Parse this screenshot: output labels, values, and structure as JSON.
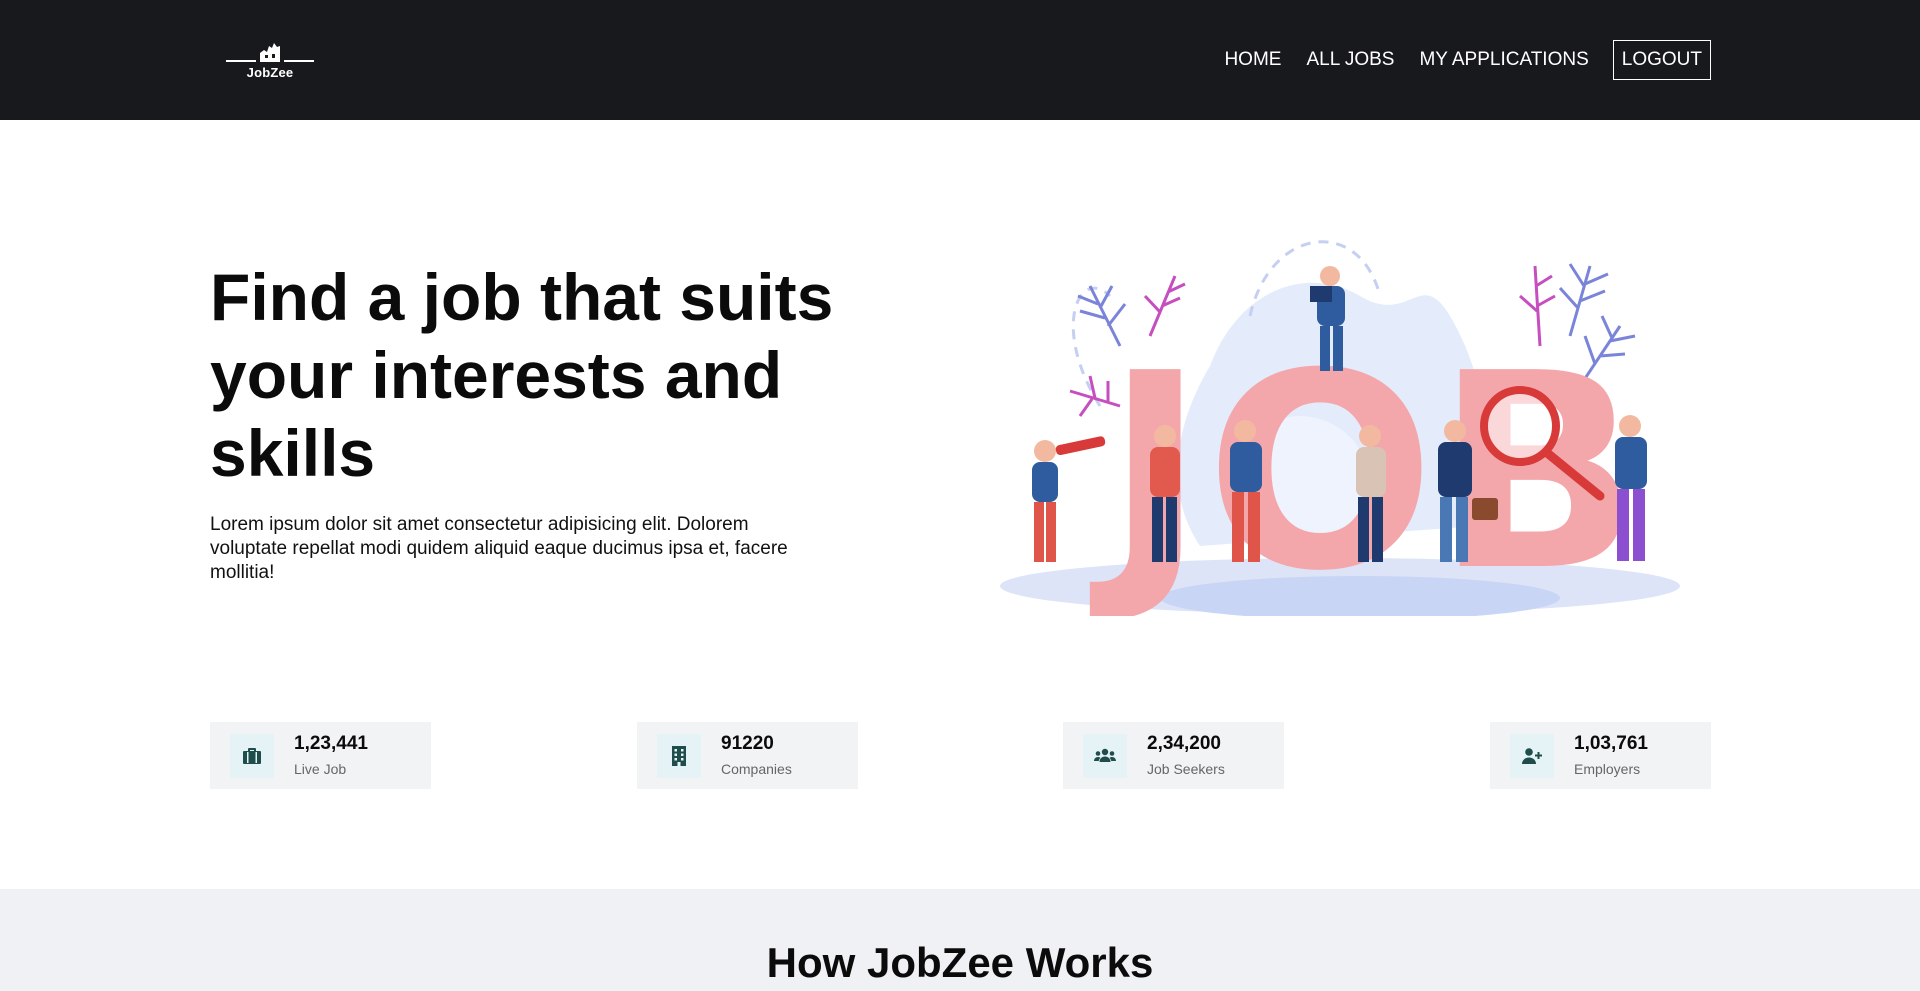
{
  "brand": {
    "name": "JobZee"
  },
  "nav": {
    "home": "HOME",
    "all_jobs": "ALL JOBS",
    "my_applications": "MY APPLICATIONS",
    "logout": "LOGOUT"
  },
  "hero": {
    "title": "Find a job that suits your interests and skills",
    "description": "Lorem ipsum dolor sit amet consectetur adipisicing elit. Dolorem voluptate repellat modi quidem aliquid eaque ducimus ipsa et, facere mollitia!",
    "illustration_text": "JOB"
  },
  "stats": [
    {
      "value": "1,23,441",
      "label": "Live Job",
      "icon": "briefcase-icon"
    },
    {
      "value": "91220",
      "label": "Companies",
      "icon": "building-icon"
    },
    {
      "value": "2,34,200",
      "label": "Job Seekers",
      "icon": "users-icon"
    },
    {
      "value": "1,03,761",
      "label": "Employers",
      "icon": "user-plus-icon"
    }
  ],
  "how": {
    "title": "How JobZee Works"
  },
  "colors": {
    "navbar_bg": "#18191d",
    "stat_bg": "#f2f3f5",
    "icon_color": "#1f4d4b",
    "section_bg": "#eff1f5"
  }
}
